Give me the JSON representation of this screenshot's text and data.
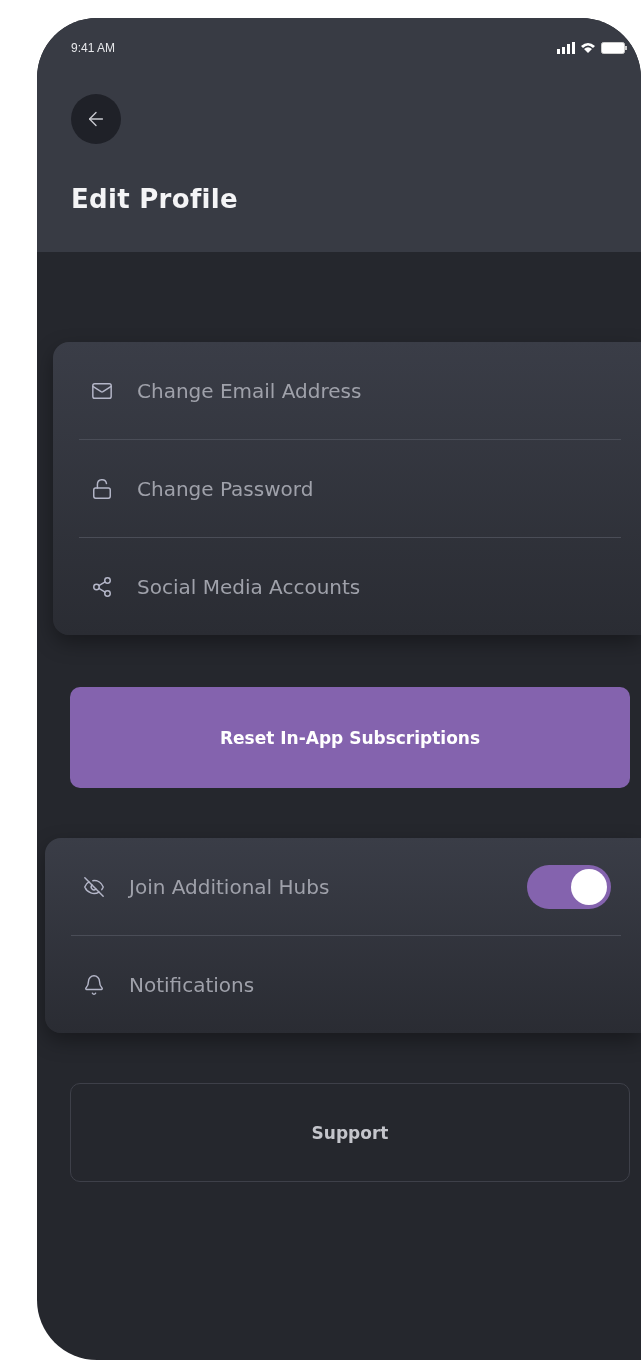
{
  "status_bar": {
    "time": "9:41 AM"
  },
  "header": {
    "title": "Edit Profile"
  },
  "account_items": [
    {
      "label": "Change Email Address"
    },
    {
      "label": "Change Password"
    },
    {
      "label": "Social Media Accounts"
    }
  ],
  "reset_button": {
    "label": "Reset In-App Subscriptions"
  },
  "preference_items": [
    {
      "label": "Join Additional Hubs",
      "kind": "toggle",
      "on": true
    },
    {
      "label": "Notifications",
      "kind": "link"
    }
  ],
  "support_button": {
    "label": "Support"
  }
}
